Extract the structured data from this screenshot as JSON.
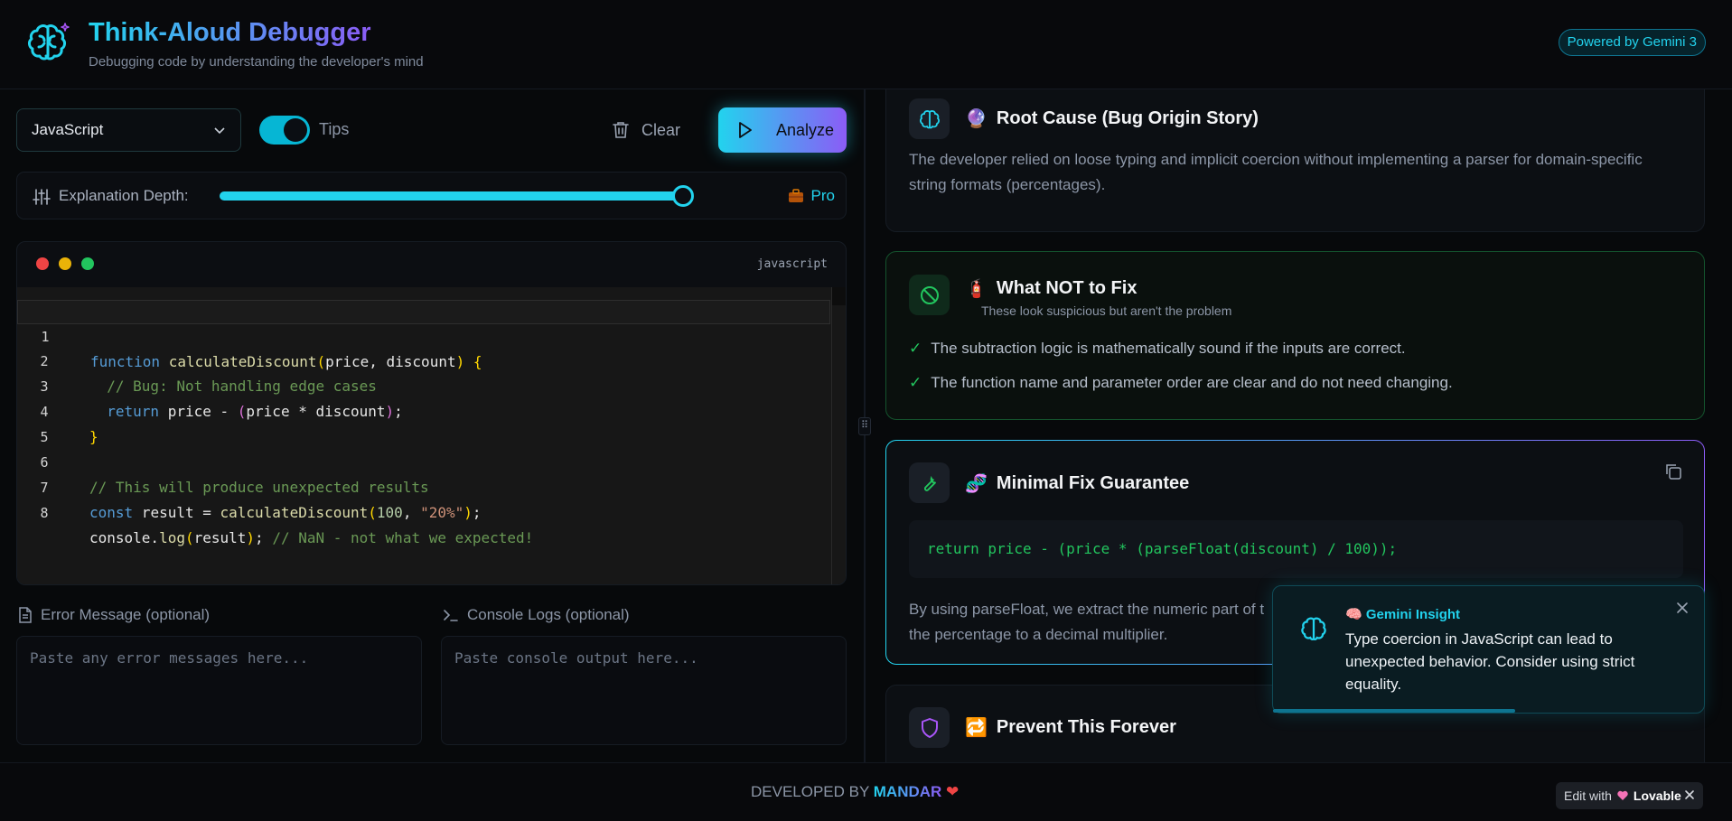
{
  "header": {
    "title": "Think-Aloud Debugger",
    "subtitle": "Debugging code by understanding the developer's mind",
    "badge": "Powered by Gemini 3"
  },
  "toolbar": {
    "language": "JavaScript",
    "tips_label": "Tips",
    "tips_on": true,
    "clear_label": "Clear",
    "analyze_label": "Analyze"
  },
  "depth": {
    "label": "Explanation Depth:",
    "level_label": "Pro",
    "level_value": 1.0
  },
  "editor": {
    "language_tag": "javascript",
    "lines": [
      {
        "n": "1"
      },
      {
        "n": "2"
      },
      {
        "n": "3"
      },
      {
        "n": "4"
      },
      {
        "n": "5"
      },
      {
        "n": "6"
      },
      {
        "n": "7"
      },
      {
        "n": "8"
      }
    ],
    "code": {
      "l1_kw": "function",
      "l1_fn": " calculateDiscount",
      "l1_p1": "(",
      "l1_args": "price, discount",
      "l1_p2": ")",
      "l1_b": " {",
      "l2": "  // Bug: Not handling edge cases",
      "l3_kw": "  return",
      "l3_a": " price - ",
      "l3_p1": "(",
      "l3_b": "price * discount",
      "l3_p2": ")",
      "l3_c": ";",
      "l4": "}",
      "l6": "// This will produce unexpected results",
      "l7_kw": "const",
      "l7_a": " result = ",
      "l7_fn": "calculateDiscount",
      "l7_p1": "(",
      "l7_num": "100",
      "l7_sep": ", ",
      "l7_str": "\"20%\"",
      "l7_p2": ")",
      "l7_c": ";",
      "l8_a": "console.",
      "l8_fn": "log",
      "l8_p1": "(",
      "l8_b": "result",
      "l8_p2": ")",
      "l8_c": ";",
      "l8_cm": " // NaN - not what we expected!"
    }
  },
  "error_field": {
    "label": "Error Message (optional)",
    "placeholder": "Paste any error messages here..."
  },
  "console_field": {
    "label": "Console Logs (optional)",
    "placeholder": "Paste console output here..."
  },
  "results": {
    "root_cause": {
      "emoji": "🔮",
      "title": "Root Cause (Bug Origin Story)",
      "text1": "The developer relied on loose typing and implicit coercion without implementing a parser for domain-specific",
      "text2": "string formats (percentages)."
    },
    "not_fix": {
      "emoji": "🧯",
      "title": "What NOT to Fix",
      "subtitle": "These look suspicious but aren't the problem",
      "items": [
        "The subtraction logic is mathematically sound if the inputs are correct.",
        "The function name and parameter order are clear and do not need changing."
      ],
      "check": "✓"
    },
    "minimal_fix": {
      "emoji": "🧬",
      "title": "Minimal Fix Guarantee",
      "code": "return price - (price * (parseFloat(discount) / 100));",
      "text1": "By using parseFloat, we extract the numeric part of t",
      "text2": "the percentage to a decimal multiplier."
    },
    "prevent": {
      "emoji": "🔁",
      "title": "Prevent This Forever"
    }
  },
  "toast": {
    "emoji": "🧠",
    "title": "Gemini Insight",
    "text": "Type coercion in JavaScript can lead to unexpected behavior. Consider using strict equality.",
    "progress": 0.56
  },
  "footer": {
    "developed_by": "DEVELOPED BY",
    "name": "MANDAR",
    "heart": "❤"
  },
  "lovable": {
    "edit_with": "Edit with",
    "brand": "Lovable"
  },
  "colors": {
    "accent": "#22d3ee",
    "accent2": "#8b5cf6",
    "success": "#22c55e"
  }
}
